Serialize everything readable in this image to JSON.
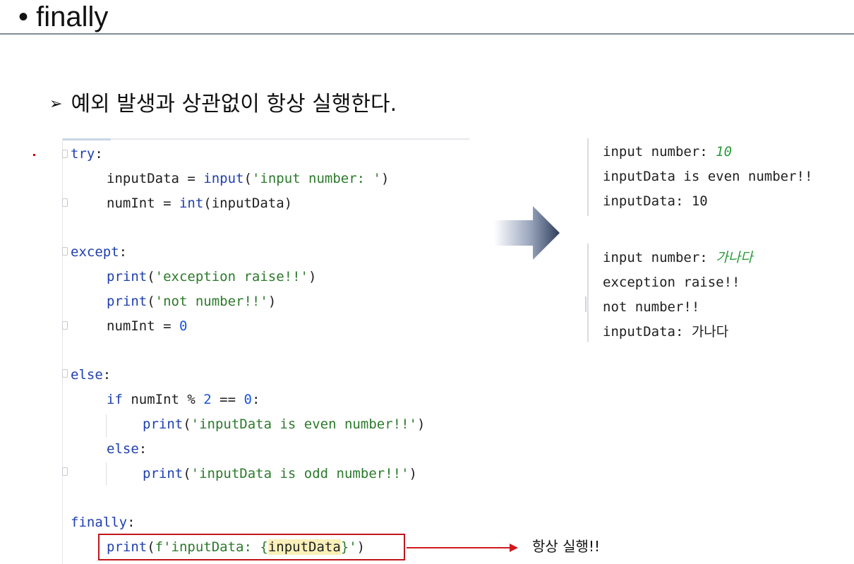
{
  "slide": {
    "title": "• finally",
    "bullet_symbol": "➢",
    "bullet_text": "예외 발생과 상관없이 항상 실행한다."
  },
  "code": {
    "try_kw": "try",
    "line_input_var": "inputData = ",
    "line_input_fn": "input",
    "line_input_str": "'input number: '",
    "line_int_var": "numInt = ",
    "line_int_fn": "int",
    "line_int_arg": "(inputData)",
    "except_kw": "except",
    "print_fn": "print",
    "str_exception": "'exception raise!!'",
    "str_not_number": "'not number!!'",
    "line_zero_var": "numInt = ",
    "zero": "0",
    "else_kw": "else",
    "if_kw": "if",
    "if_expr": " numInt % ",
    "two": "2",
    "eq": " == ",
    "str_even": "'inputData is even number!!'",
    "str_odd": "'inputData is odd number!!'",
    "finally_kw": "finally",
    "fstring_prefix": "f'inputData: {",
    "fstring_var": "inputData",
    "fstring_suffix": "}'"
  },
  "output1": {
    "prompt": "input number: ",
    "typed": "10",
    "line2": "inputData is even number!!",
    "line3": "inputData: 10"
  },
  "output2": {
    "prompt": "input number: ",
    "typed": "가나다",
    "line2": "exception raise!!",
    "line3": "not number!!",
    "line4": "inputData: 가나다"
  },
  "annotation": {
    "always_label": "항상 실행!!"
  },
  "colors": {
    "keyword": "#1f3fb0",
    "string": "#2c7a2c",
    "number": "#1a55d8",
    "highlight_box": "#c0161c",
    "arrow_dark": "#2f3d5c"
  }
}
